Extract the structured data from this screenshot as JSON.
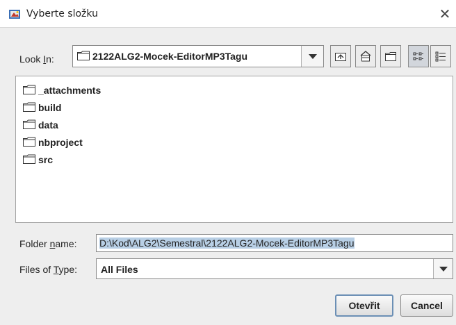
{
  "window": {
    "title": "Vyberte složku",
    "close_glyph": "✕",
    "icon": "java-app-icon"
  },
  "look_in": {
    "label_prefix": "Look ",
    "label_mnemonic": "I",
    "label_suffix": "n:",
    "value": "2122ALG2-Mocek-EditorMP3Tagu"
  },
  "toolbar": {
    "buttons": [
      {
        "name": "up-one-level",
        "icon": "up-folder-icon"
      },
      {
        "name": "home",
        "icon": "home-icon"
      },
      {
        "name": "new-folder",
        "icon": "new-folder-icon"
      },
      {
        "name": "list-view",
        "icon": "list-view-icon",
        "pressed": true
      },
      {
        "name": "details-view",
        "icon": "details-view-icon"
      }
    ]
  },
  "files": [
    {
      "name": "_attachments"
    },
    {
      "name": "build"
    },
    {
      "name": "data"
    },
    {
      "name": "nbproject"
    },
    {
      "name": "src"
    }
  ],
  "folder_name": {
    "label_prefix": "Folder ",
    "label_mnemonic": "n",
    "label_suffix": "ame:",
    "value": "D:\\Kod\\ALG2\\Semestral\\2122ALG2-Mocek-EditorMP3Tagu"
  },
  "files_of_type": {
    "label_prefix": "Files of ",
    "label_mnemonic": "T",
    "label_suffix": "ype:",
    "value": "All Files"
  },
  "buttons": {
    "open": "Otevřit",
    "cancel": "Cancel"
  }
}
